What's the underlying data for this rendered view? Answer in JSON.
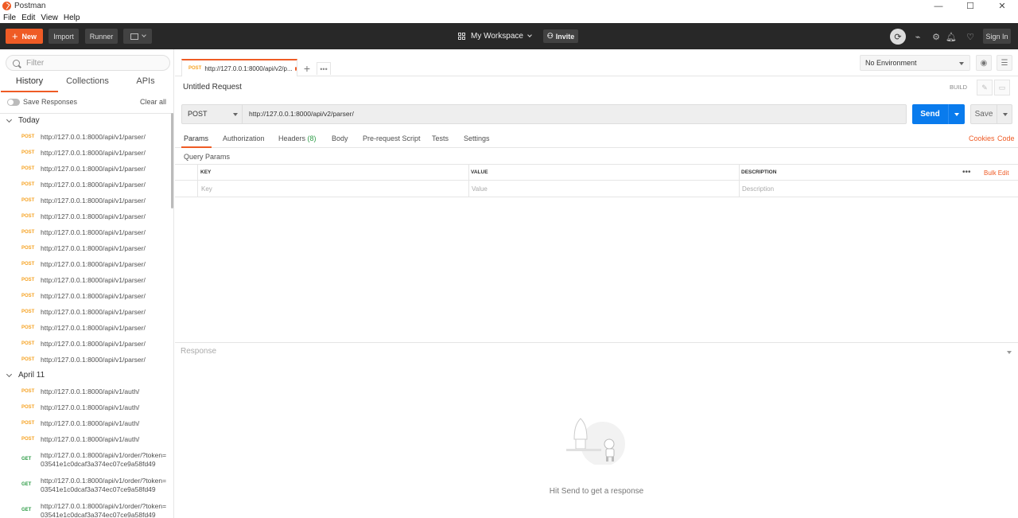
{
  "window": {
    "title": "Postman",
    "minimize": "—",
    "maximize": "☐",
    "close": "✕"
  },
  "menu": [
    "File",
    "Edit",
    "View",
    "Help"
  ],
  "header": {
    "new_label": "New",
    "import_label": "Import",
    "runner_label": "Runner",
    "workspace": "My Workspace",
    "invite": "Invite",
    "sign_in": "Sign In",
    "brand_color": "#ef5b25"
  },
  "sidebar": {
    "filter_placeholder": "Filter",
    "tabs": [
      "History",
      "Collections",
      "APIs"
    ],
    "save_responses": "Save Responses",
    "clear_all": "Clear all",
    "groups": [
      {
        "label": "Today"
      },
      {
        "label": "April 11"
      }
    ],
    "today": [
      {
        "method": "POST",
        "url": "http://127.0.0.1:8000/api/v1/parser/"
      },
      {
        "method": "POST",
        "url": "http://127.0.0.1:8000/api/v1/parser/"
      },
      {
        "method": "POST",
        "url": "http://127.0.0.1:8000/api/v1/parser/"
      },
      {
        "method": "POST",
        "url": "http://127.0.0.1:8000/api/v1/parser/"
      },
      {
        "method": "POST",
        "url": "http://127.0.0.1:8000/api/v1/parser/"
      },
      {
        "method": "POST",
        "url": "http://127.0.0.1:8000/api/v1/parser/"
      },
      {
        "method": "POST",
        "url": "http://127.0.0.1:8000/api/v1/parser/"
      },
      {
        "method": "POST",
        "url": "http://127.0.0.1:8000/api/v1/parser/"
      },
      {
        "method": "POST",
        "url": "http://127.0.0.1:8000/api/v1/parser/"
      },
      {
        "method": "POST",
        "url": "http://127.0.0.1:8000/api/v1/parser/"
      },
      {
        "method": "POST",
        "url": "http://127.0.0.1:8000/api/v1/parser/"
      },
      {
        "method": "POST",
        "url": "http://127.0.0.1:8000/api/v1/parser/"
      },
      {
        "method": "POST",
        "url": "http://127.0.0.1:8000/api/v1/parser/"
      },
      {
        "method": "POST",
        "url": "http://127.0.0.1:8000/api/v1/parser/"
      },
      {
        "method": "POST",
        "url": "http://127.0.0.1:8000/api/v1/parser/"
      }
    ],
    "april11": [
      {
        "method": "POST",
        "url": "http://127.0.0.1:8000/api/v1/auth/"
      },
      {
        "method": "POST",
        "url": "http://127.0.0.1:8000/api/v1/auth/"
      },
      {
        "method": "POST",
        "url": "http://127.0.0.1:8000/api/v1/auth/"
      },
      {
        "method": "POST",
        "url": "http://127.0.0.1:8000/api/v1/auth/"
      },
      {
        "method": "GET",
        "url": "http://127.0.0.1:8000/api/v1/order/?token=03541e1c0dcaf3a374ec07ce9a58fd49"
      },
      {
        "method": "GET",
        "url": "http://127.0.0.1:8000/api/v1/order/?token=03541e1c0dcaf3a374ec07ce9a58fd49"
      },
      {
        "method": "GET",
        "url": "http://127.0.0.1:8000/api/v1/order/?token=03541e1c0dcaf3a374ec07ce9a58fd49"
      }
    ]
  },
  "request_tab": {
    "method": "POST",
    "url": "http://127.0.0.1:8000/api/v2/p..."
  },
  "environment": {
    "selected": "No Environment"
  },
  "request": {
    "title": "Untitled Request",
    "build": "BUILD",
    "method": "POST",
    "url": "http://127.0.0.1:8000/api/v2/parser/",
    "send": "Send",
    "save": "Save",
    "send_color": "#097bed"
  },
  "req_tabs": {
    "params": "Params",
    "authorization": "Authorization",
    "headers": "Headers",
    "headers_count": "(8)",
    "body": "Body",
    "prescript": "Pre-request Script",
    "tests": "Tests",
    "settings": "Settings",
    "cookies": "Cookies",
    "code": "Code"
  },
  "params": {
    "title": "Query Params",
    "col_key": "KEY",
    "col_value": "VALUE",
    "col_desc": "DESCRIPTION",
    "bulk_edit": "Bulk Edit",
    "ph_key": "Key",
    "ph_value": "Value",
    "ph_desc": "Description",
    "more": "•••"
  },
  "response": {
    "label": "Response",
    "hint": "Hit Send to get a response"
  }
}
